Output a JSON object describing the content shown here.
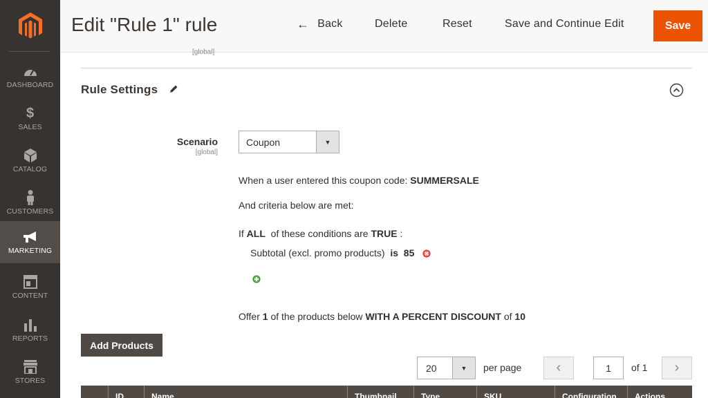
{
  "sidebar": {
    "items": [
      {
        "label": "DASHBOARD",
        "icon": "dashboard-icon"
      },
      {
        "label": "SALES",
        "icon": "dollar-icon"
      },
      {
        "label": "CATALOG",
        "icon": "box-icon"
      },
      {
        "label": "CUSTOMERS",
        "icon": "person-icon"
      },
      {
        "label": "MARKETING",
        "icon": "megaphone-icon",
        "active": true
      },
      {
        "label": "CONTENT",
        "icon": "layout-icon"
      },
      {
        "label": "REPORTS",
        "icon": "bar-chart-icon"
      },
      {
        "label": "STORES",
        "icon": "store-icon"
      }
    ]
  },
  "header": {
    "title": "Edit \"Rule 1\" rule",
    "back_label": "Back",
    "delete_label": "Delete",
    "reset_label": "Reset",
    "save_continue_label": "Save and Continue Edit",
    "save_label": "Save"
  },
  "scope_top": "[global]",
  "section": {
    "title": "Rule Settings"
  },
  "scenario": {
    "label": "Scenario",
    "scope": "[global]",
    "value": "Coupon"
  },
  "coupon_line": {
    "prefix": "When a user entered this coupon code:",
    "code": "SUMMERSALE"
  },
  "criteria_line": "And criteria below are met:",
  "conditions": {
    "if": "If",
    "aggregator": "ALL",
    "middle": "of these conditions are",
    "value": "TRUE",
    "suffix": ":",
    "rule_attribute": "Subtotal (excl. promo products)",
    "rule_operator": "is",
    "rule_value": "85"
  },
  "offer": {
    "t1": "Offer",
    "count": "1",
    "t2": "of the products below",
    "type": "WITH A PERCENT DISCOUNT",
    "t3": "of",
    "amount": "10"
  },
  "add_products_label": "Add Products",
  "pagination": {
    "per_page_value": "20",
    "per_page_label": "per page",
    "current_page": "1",
    "of_pages": "of 1"
  },
  "grid_columns": [
    "",
    "ID",
    "Name",
    "Thumbnail",
    "Type",
    "SKU",
    "Configuration",
    "Actions"
  ],
  "colors": {
    "sidebar_bg": "#373330",
    "sidebar_active": "#524d49",
    "save_orange": "#eb5202",
    "logo_orange": "#f46f25",
    "dark_button": "#514943"
  }
}
